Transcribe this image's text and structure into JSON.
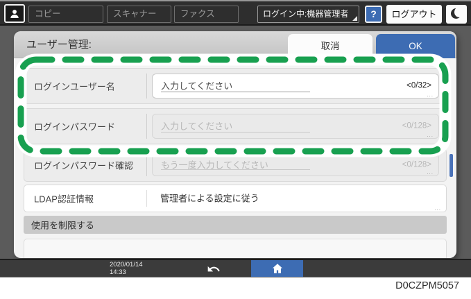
{
  "top_bar": {
    "tabs": [
      {
        "label": "コピー"
      },
      {
        "label": "スキャナー"
      },
      {
        "label": "ファクス"
      }
    ],
    "login_status": "ログイン中:機器管理者",
    "help_label": "?",
    "logout_label": "ログアウト"
  },
  "panel": {
    "title": "ユーザー管理:",
    "cancel_label": "取消",
    "ok_label": "OK"
  },
  "form": {
    "rows": [
      {
        "label": "ログインユーザー名",
        "placeholder": "入力してください",
        "counter": "<0/32>",
        "more": "..."
      },
      {
        "label": "ログインパスワード",
        "placeholder": "入力してください",
        "counter": "<0/128>",
        "more": "..."
      },
      {
        "label": "ログインパスワード確認",
        "placeholder": "もう一度入力してください",
        "counter": "<0/128>",
        "more": "..."
      },
      {
        "label": "LDAP認証情報",
        "value": "管理者による設定に従う",
        "more": "..."
      },
      {
        "label": "使用を制限する"
      }
    ]
  },
  "bottom_bar": {
    "date": "2020/01/14",
    "time": "14:33"
  },
  "caption": "D0CZPM5057",
  "icons": {
    "user": "user-icon",
    "help": "question-mark-icon",
    "energy_saver": "crescent-moon-icon",
    "dropdown_corner": "corner-triangle-icon",
    "back": "undo-arrow-icon",
    "home": "home-icon"
  },
  "colors": {
    "accent_blue": "#3d6cb3",
    "highlight_green": "#18a050",
    "scrollbar_blue": "#4a72b8"
  }
}
